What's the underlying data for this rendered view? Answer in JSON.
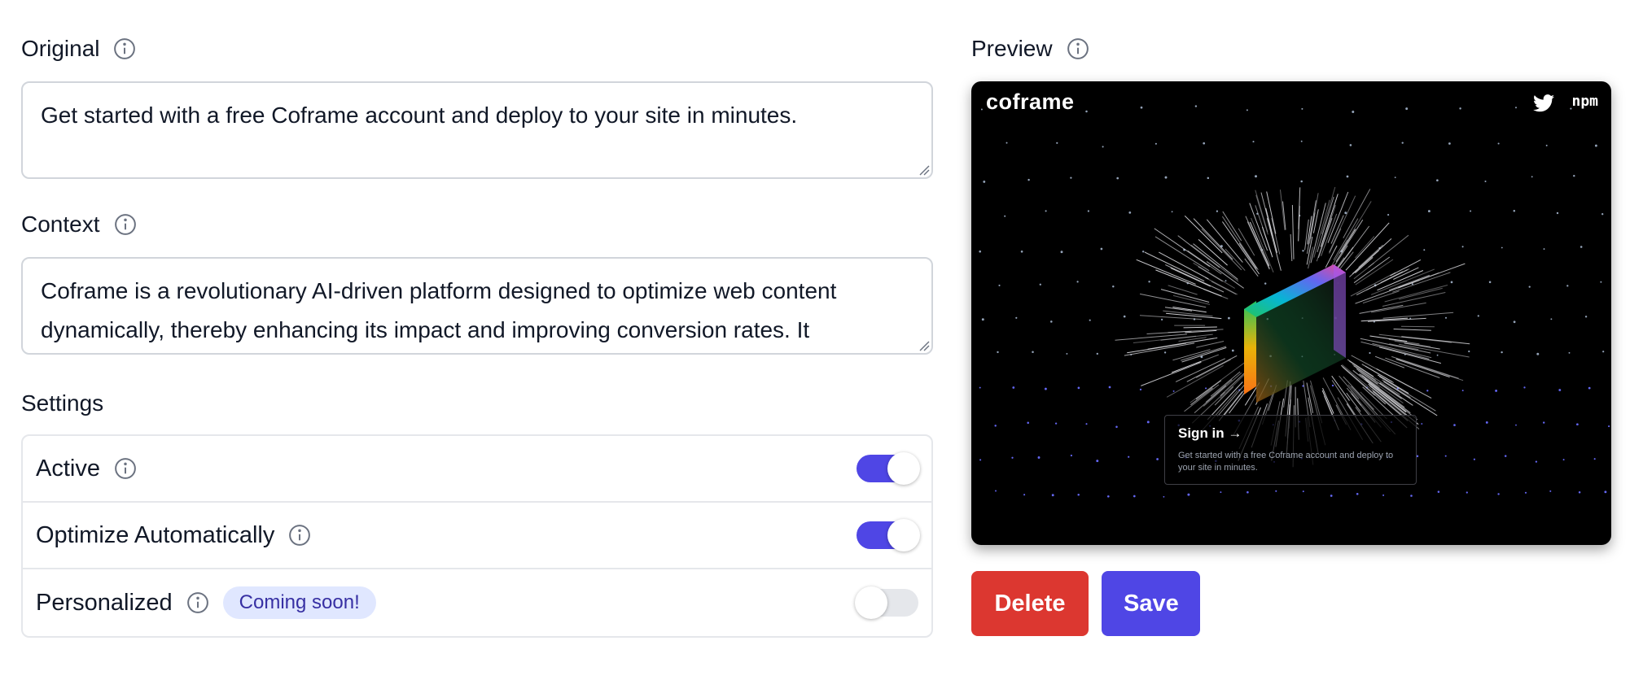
{
  "original": {
    "label": "Original",
    "value": "Get started with a free Coframe account and deploy to your site in minutes."
  },
  "context": {
    "label": "Context",
    "value": "Coframe is a revolutionary AI-driven platform designed to optimize web content dynamically, thereby enhancing its impact and improving conversion rates. It"
  },
  "settings": {
    "title": "Settings",
    "items": [
      {
        "label": "Active",
        "enabled": true
      },
      {
        "label": "Optimize Automatically",
        "enabled": true
      },
      {
        "label": "Personalized",
        "badge": "Coming soon!",
        "enabled": false
      }
    ]
  },
  "preview": {
    "label": "Preview",
    "logo": "coframe",
    "npm_label": "npm",
    "card_title": "Sign in →",
    "card_desc": "Get started with a free Coframe account and deploy to your site in minutes."
  },
  "actions": {
    "delete_label": "Delete",
    "save_label": "Save"
  },
  "colors": {
    "accent": "#4f46e5",
    "danger": "#dc3730",
    "badge_bg": "#e0e7ff",
    "badge_text": "#3730a3"
  }
}
